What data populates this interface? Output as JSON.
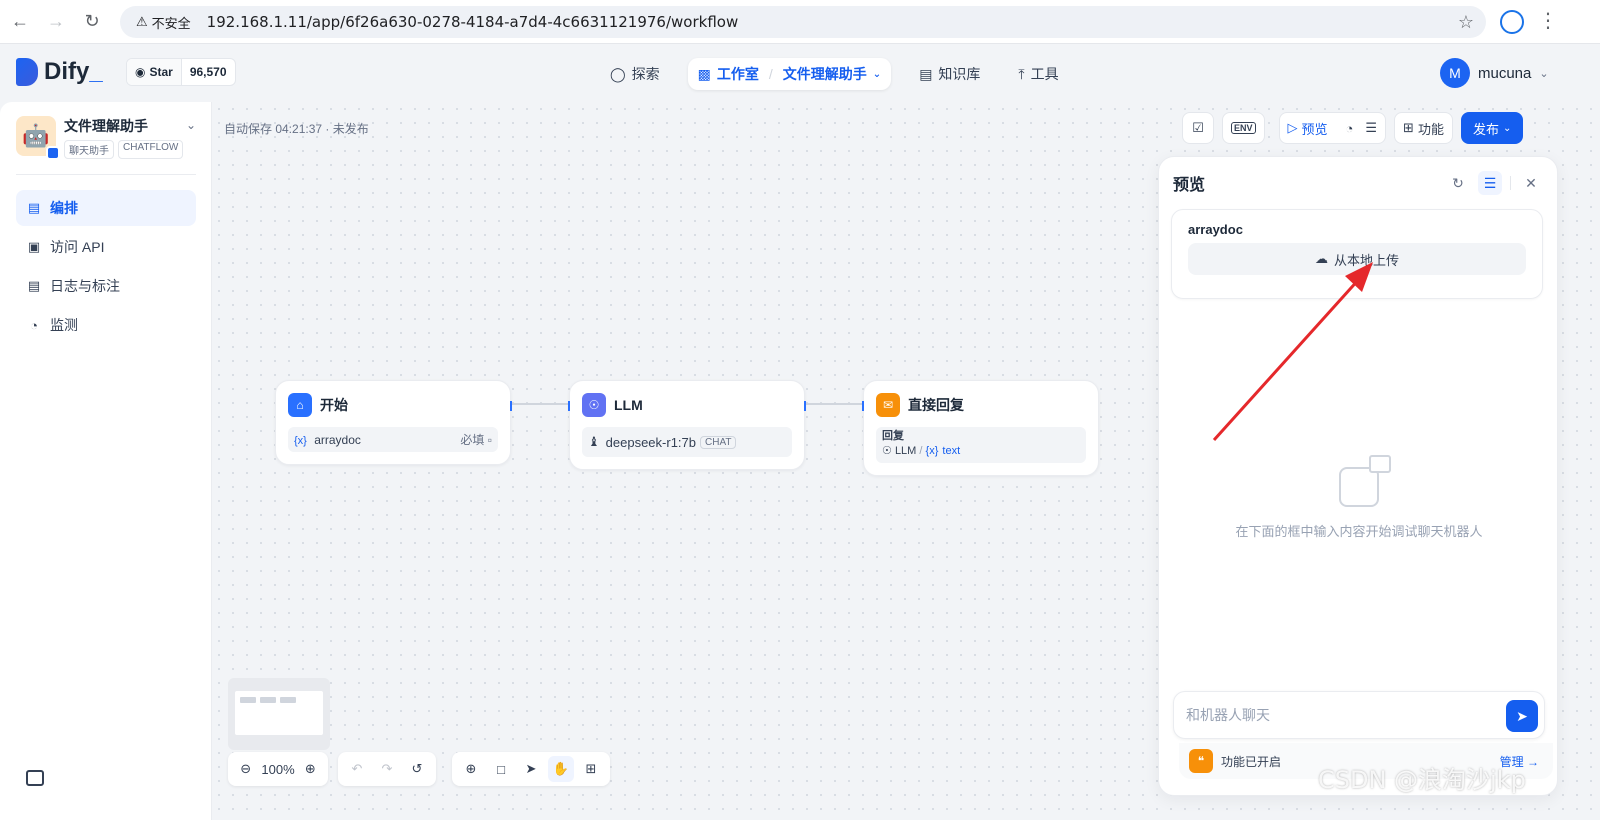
{
  "browser": {
    "insecure_label": "不安全",
    "url": "192.168.1.11/app/6f26a630-0278-4184-a7d4-4c6631121976/workflow"
  },
  "header": {
    "logo_text": "Dify",
    "github": {
      "star_label": "Star",
      "count": "96,570"
    },
    "nav": {
      "explore": "探索",
      "studio": "工作室",
      "app_name": "文件理解助手",
      "knowledge": "知识库",
      "tools": "工具"
    },
    "user": {
      "initial": "M",
      "name": "mucuna"
    }
  },
  "sidebar": {
    "app": {
      "name": "文件理解助手",
      "mode_tag": "聊天助手",
      "type_tag": "CHATFLOW"
    },
    "items": [
      {
        "label": "编排",
        "icon": "layout-icon",
        "active": true
      },
      {
        "label": "访问 API",
        "icon": "terminal-icon",
        "active": false
      },
      {
        "label": "日志与标注",
        "icon": "document-icon",
        "active": false
      },
      {
        "label": "监测",
        "icon": "gauge-icon",
        "active": false
      }
    ]
  },
  "canvas": {
    "autosave": "自动保存 04:21:37 · 未发布",
    "toolbar": {
      "env_label": "ENV",
      "preview_label": "预览",
      "features_label": "功能",
      "publish_label": "发布"
    },
    "nodes": {
      "start": {
        "title": "开始",
        "var_mark": "{x}",
        "var_name": "arraydoc",
        "required": "必填"
      },
      "llm": {
        "title": "LLM",
        "model": "deepseek-r1:7b",
        "mode": "CHAT"
      },
      "answer": {
        "title": "直接回复",
        "label": "回复",
        "source": "LLM",
        "sep": "/",
        "var_mark": "{x}",
        "var_name": "text"
      }
    },
    "zoom": "100%"
  },
  "preview": {
    "title": "预览",
    "field_label": "arraydoc",
    "upload_label": "从本地上传",
    "empty_text": "在下面的框中输入内容开始调试聊天机器人",
    "chat_placeholder": "和机器人聊天",
    "feature_text": "功能已开启",
    "manage_label": "管理"
  },
  "watermark": "CSDN @浪淘沙jkp",
  "colors": {
    "primary": "#155eef",
    "start_node": "#2970ff",
    "llm_node": "#6172f3",
    "answer_node": "#f79009",
    "arrow": "#e5282b"
  }
}
